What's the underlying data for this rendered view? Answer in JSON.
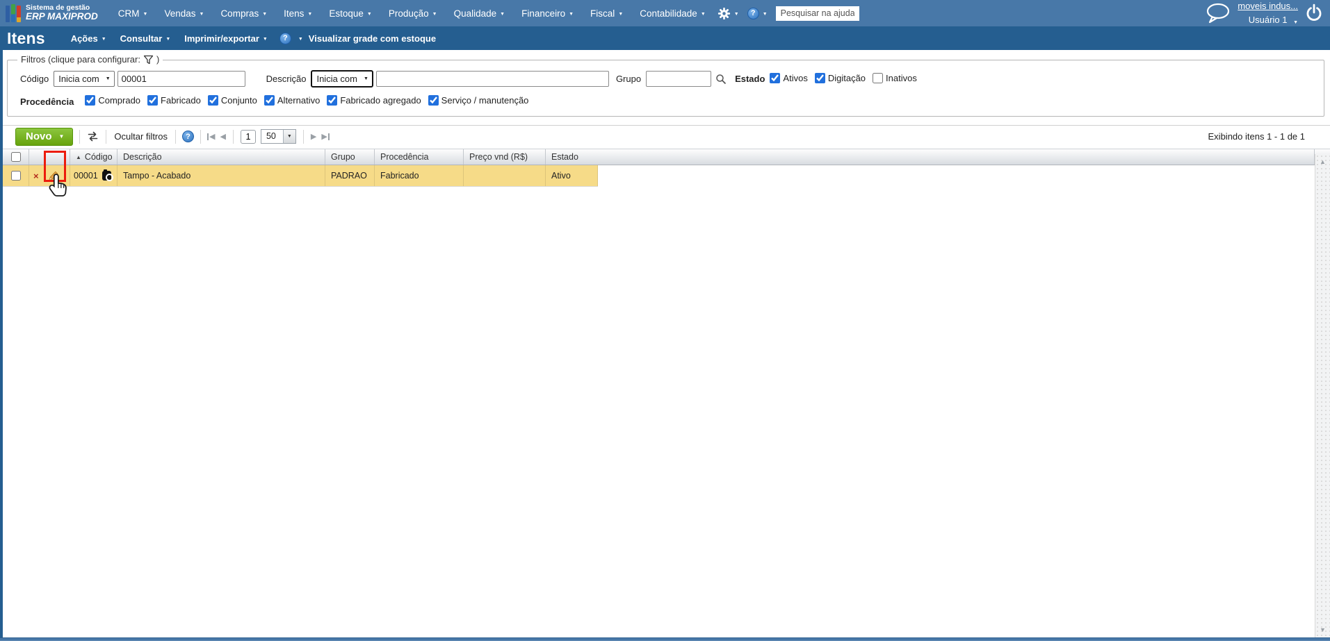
{
  "topbar": {
    "brand_line1": "Sistema de gestão",
    "brand_line2": "ERP MAXIPROD",
    "menus": [
      "CRM",
      "Vendas",
      "Compras",
      "Itens",
      "Estoque",
      "Produção",
      "Qualidade",
      "Financeiro",
      "Fiscal",
      "Contabilidade"
    ],
    "search_placeholder": "Pesquisar na ajuda...",
    "account_link": "moveis indus...",
    "user_label": "Usuário 1"
  },
  "titlebar": {
    "title": "Itens",
    "menus": [
      "Ações",
      "Consultar",
      "Imprimir/exportar"
    ],
    "extra_link": "Visualizar grade com estoque"
  },
  "filters": {
    "legend_prefix": "Filtros (clique para configurar:",
    "legend_suffix": ")",
    "codigo_label": "Código",
    "codigo_operator": "Inicia com",
    "codigo_value": "00001",
    "descricao_label": "Descrição",
    "descricao_operator": "Inicia com",
    "descricao_value": "",
    "grupo_label": "Grupo",
    "grupo_value": "",
    "estado_label": "Estado",
    "estado_options": [
      {
        "label": "Ativos",
        "checked": true
      },
      {
        "label": "Digitação",
        "checked": true
      },
      {
        "label": "Inativos",
        "checked": false
      }
    ],
    "procedencia_label": "Procedência",
    "procedencia_options": [
      {
        "label": "Comprado",
        "checked": true
      },
      {
        "label": "Fabricado",
        "checked": true
      },
      {
        "label": "Conjunto",
        "checked": true
      },
      {
        "label": "Alternativo",
        "checked": true
      },
      {
        "label": "Fabricado agregado",
        "checked": true
      },
      {
        "label": "Serviço / manutenção",
        "checked": true
      }
    ]
  },
  "toolbar": {
    "new_button": "Novo",
    "hide_filters": "Ocultar filtros",
    "page_value": "1",
    "page_size": "50",
    "showing_text": "Exibindo itens 1 - 1 de 1"
  },
  "grid": {
    "columns": [
      "Código",
      "Descrição",
      "Grupo",
      "Procedência",
      "Preço vnd (R$)",
      "Estado"
    ],
    "rows": [
      {
        "codigo": "00001",
        "descricao": "Tampo - Acabado",
        "grupo": "PADRAO",
        "procedencia": "Fabricado",
        "preco": "",
        "estado": "Ativo"
      }
    ]
  },
  "colors": {
    "topbar_blue": "#4878a8",
    "titlebar_blue": "#255e90",
    "row_yellow": "#f6db88",
    "button_green": "#67a30d",
    "checkbox_blue": "#2170dd",
    "annotation_red": "#ec1c0c"
  }
}
